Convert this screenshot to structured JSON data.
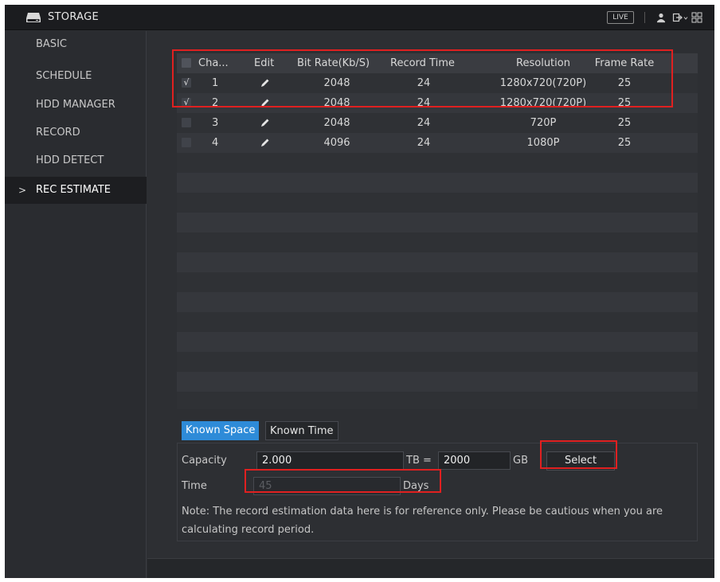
{
  "titlebar": {
    "title": "STORAGE",
    "live_label": "LIVE",
    "icons": [
      "storage-icon",
      "user-icon",
      "logout-icon",
      "grid-menu-icon"
    ]
  },
  "sidebar": {
    "items": [
      {
        "label": "BASIC",
        "active": false
      },
      {
        "label": "SCHEDULE",
        "active": false
      },
      {
        "label": "HDD MANAGER",
        "active": false
      },
      {
        "label": "RECORD",
        "active": false
      },
      {
        "label": "HDD DETECT",
        "active": false
      },
      {
        "label": "REC ESTIMATE",
        "active": true,
        "marker": ">"
      }
    ]
  },
  "table": {
    "headers": [
      "Cha...",
      "Edit",
      "Bit Rate(Kb/S)",
      "Record Time",
      "Resolution",
      "Frame Rate"
    ],
    "rows": [
      {
        "checked": true,
        "channel": "1",
        "bitrate": "2048",
        "record_time": "24",
        "resolution": "1280x720(720P)",
        "frame_rate": "25"
      },
      {
        "checked": true,
        "channel": "2",
        "bitrate": "2048",
        "record_time": "24",
        "resolution": "1280x720(720P)",
        "frame_rate": "25"
      },
      {
        "checked": false,
        "channel": "3",
        "bitrate": "2048",
        "record_time": "24",
        "resolution": "720P",
        "frame_rate": "25"
      },
      {
        "checked": false,
        "channel": "4",
        "bitrate": "4096",
        "record_time": "24",
        "resolution": "1080P",
        "frame_rate": "25"
      }
    ],
    "check_mark": "√"
  },
  "tabs": {
    "known_space": "Known Space",
    "known_time": "Known Time",
    "active": "known_space"
  },
  "form": {
    "capacity_label": "Capacity",
    "capacity_value": "2.000",
    "tb_label": "TB =",
    "gb_value": "2000",
    "gb_label": "GB",
    "select_label": "Select",
    "time_label": "Time",
    "time_value": "45",
    "days_label": "Days",
    "note_line1": "Note: The record estimation data here is for reference only. Please be cautious when you are",
    "note_line2": "calculating record period."
  },
  "colors": {
    "accent": "#2e8bd8",
    "highlight": "#e02020",
    "background": "#2d2f33"
  }
}
